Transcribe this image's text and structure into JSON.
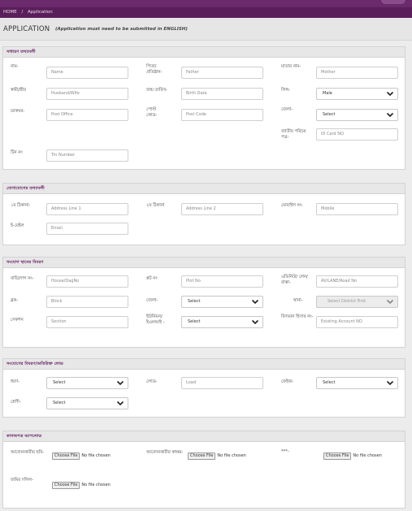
{
  "breadcrumb": {
    "home": "HOME",
    "sep": "/",
    "current": "Application"
  },
  "header": {
    "title": "APPLICATION",
    "note": "(Application must need to be submitted in ENGLISH)"
  },
  "general": {
    "heading": "সাধারণ তথ্যাবলী",
    "name_label": "নাম-",
    "name_ph": "Name",
    "father_label": "পিতা/ প্রতিষ্ঠান-",
    "father_ph": "Father",
    "mother_label": "মাতার নাম-",
    "mother_ph": "Mother",
    "husband_label": "স্বামী/স্ত্রীর",
    "husband_ph": "Husband/Wife",
    "birth_label": "জন্ম তারিখ-",
    "birth_ph": "Birth Date",
    "gender_label": "লিঙ্গ-",
    "gender_value": "Male",
    "po_label": "ডাকঘর-",
    "po_ph": "Post Office",
    "postcode_label": "পোস্ট কোড-",
    "postcode_ph": "Post Code",
    "district_label": "জেলা-",
    "district_value": "Select",
    "nid_label": "জাতীয় পরিচয় পত্র-",
    "nid_ph": "ID Card NO",
    "tin_label": "টিন নং",
    "tin_ph": "Tin Number"
  },
  "contact": {
    "heading": "যোগাযোগের তথ্যাবলী",
    "addr1_label": "১ম ঠিকানা-",
    "addr1_ph": "Address Line 1",
    "addr2_label": "২য় ঠিকানা",
    "addr2_ph": "Address Line 2",
    "mobile_label": "মোবাইল নং-",
    "mobile_ph": "Mobile",
    "email_label": "ই-মেইল",
    "email_ph": "Email"
  },
  "location": {
    "heading": "সংযোগ স্থানের বিবরণ",
    "house_label": "বাড়ি/দাগ নং-",
    "house_ph": "House/DagNo",
    "plot_label": "প্লট নং",
    "plot_ph": "Plot No",
    "avenue_label": "এভিনিউ/ লেন/রাস্তা-",
    "avenue_ph": "AV/LANE/Road No",
    "block_label": "ব্লক-",
    "block_ph": "Block",
    "district_label": "জেলা-",
    "district_value": "Select",
    "thana_label": "থানা-",
    "thana_value": "Select District First",
    "section_label": "সেকশন",
    "section_ph": "Section",
    "union_label": "ইউনিয়ন/ ইএনআই -",
    "union_value": "Select",
    "account_label": "বিদ্যমান হিসাব নং-",
    "account_ph": "Existing Account NO"
  },
  "connection": {
    "heading": "সংযোগের বিবরণ/অতিরিক্ত লোড",
    "type_label": "ধরণ-",
    "type_value": "Select",
    "load_label": "লোড-",
    "load_ph": "Load",
    "phase_label": "ফেইজ-",
    "phase_value": "Select",
    "class_label": "শ্রেণী-",
    "class_value": "Select"
  },
  "documents": {
    "heading": "কাগজপত্র আপলোড",
    "photo_label": "আবেদনকারীর ছবি-",
    "sign_label": "আবেদনকারীর স্বাক্ষর-",
    "other_label": "***-",
    "land_label": "জমির দলিল-",
    "choose_btn": "Choose File",
    "no_file": "No file chosen"
  }
}
